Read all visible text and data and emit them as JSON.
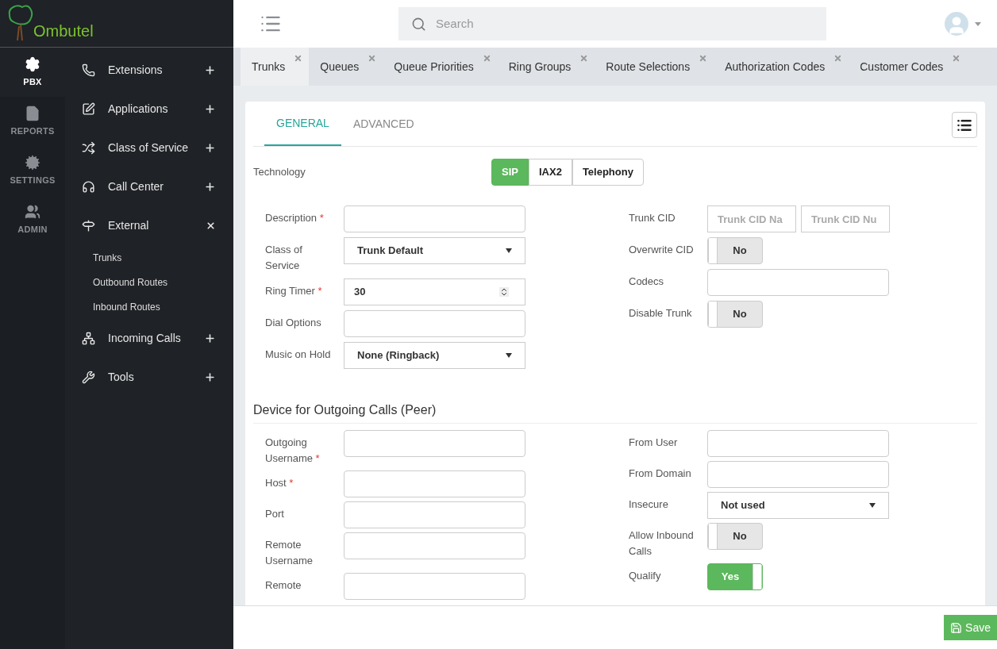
{
  "brand": {
    "name": "Ombutel"
  },
  "rail": [
    {
      "label": "PBX",
      "selected": true
    },
    {
      "label": "REPORTS",
      "selected": false
    },
    {
      "label": "SETTINGS",
      "selected": false
    },
    {
      "label": "ADMIN",
      "selected": false
    }
  ],
  "menu": [
    {
      "label": "Extensions",
      "expanded": false
    },
    {
      "label": "Applications",
      "expanded": false
    },
    {
      "label": "Class of Service",
      "expanded": false
    },
    {
      "label": "Call Center",
      "expanded": false
    },
    {
      "label": "External",
      "expanded": true,
      "children": [
        {
          "label": "Trunks"
        },
        {
          "label": "Outbound Routes"
        },
        {
          "label": "Inbound Routes"
        }
      ]
    },
    {
      "label": "Incoming Calls",
      "expanded": false
    },
    {
      "label": "Tools",
      "expanded": false
    }
  ],
  "search": {
    "placeholder": "Search"
  },
  "tabs": [
    {
      "label": "Trunks",
      "selected": true
    },
    {
      "label": "Queues",
      "selected": false
    },
    {
      "label": "Queue Priorities",
      "selected": false
    },
    {
      "label": "Ring Groups",
      "selected": false
    },
    {
      "label": "Route Selections",
      "selected": false
    },
    {
      "label": "Authorization Codes",
      "selected": false
    },
    {
      "label": "Customer Codes",
      "selected": false
    }
  ],
  "form_tabs": [
    {
      "label": "GENERAL",
      "selected": true
    },
    {
      "label": "ADVANCED",
      "selected": false
    }
  ],
  "technology": {
    "label": "Technology",
    "options": [
      {
        "label": "SIP",
        "selected": true
      },
      {
        "label": "IAX2",
        "selected": false
      },
      {
        "label": "Telephony",
        "selected": false
      }
    ]
  },
  "general_left": [
    {
      "kind": "input",
      "label": "Description",
      "required_mark": "*"
    },
    {
      "kind": "select",
      "label": "Class of Service",
      "value": "Trunk Default"
    },
    {
      "kind": "number",
      "label": "Ring Timer",
      "required_mark": "*",
      "value": "30"
    },
    {
      "kind": "input",
      "label": "Dial Options"
    },
    {
      "kind": "select",
      "label": "Music on Hold",
      "value": "None (Ringback)"
    }
  ],
  "general_right": [
    {
      "kind": "pair",
      "label": "Trunk CID",
      "placeholders": [
        "Trunk CID Na",
        "Trunk CID Nu"
      ]
    },
    {
      "kind": "toggle",
      "label": "Overwrite CID",
      "on": false,
      "value": "No"
    },
    {
      "kind": "input",
      "label": "Codecs"
    },
    {
      "kind": "toggle",
      "label": "Disable Trunk",
      "on": false,
      "value": "No"
    }
  ],
  "peer_section": {
    "title": "Device for Outgoing Calls (Peer)"
  },
  "peer_left": [
    {
      "kind": "input",
      "label": "Outgoing Username",
      "required_mark": "*"
    },
    {
      "kind": "input",
      "label": "Host",
      "required_mark": "*"
    },
    {
      "kind": "input",
      "label": "Port"
    },
    {
      "kind": "input",
      "label": "Remote Username"
    },
    {
      "kind": "input",
      "label": "Remote"
    }
  ],
  "peer_right": [
    {
      "kind": "input",
      "label": "From User"
    },
    {
      "kind": "input",
      "label": "From Domain"
    },
    {
      "kind": "select",
      "label": "Insecure",
      "value": "Not used"
    },
    {
      "kind": "toggle",
      "label": "Allow Inbound Calls",
      "on": false,
      "value": "No"
    },
    {
      "kind": "toggle",
      "label": "Qualify",
      "on": true,
      "value": "Yes"
    }
  ],
  "save": {
    "label": "Save"
  }
}
